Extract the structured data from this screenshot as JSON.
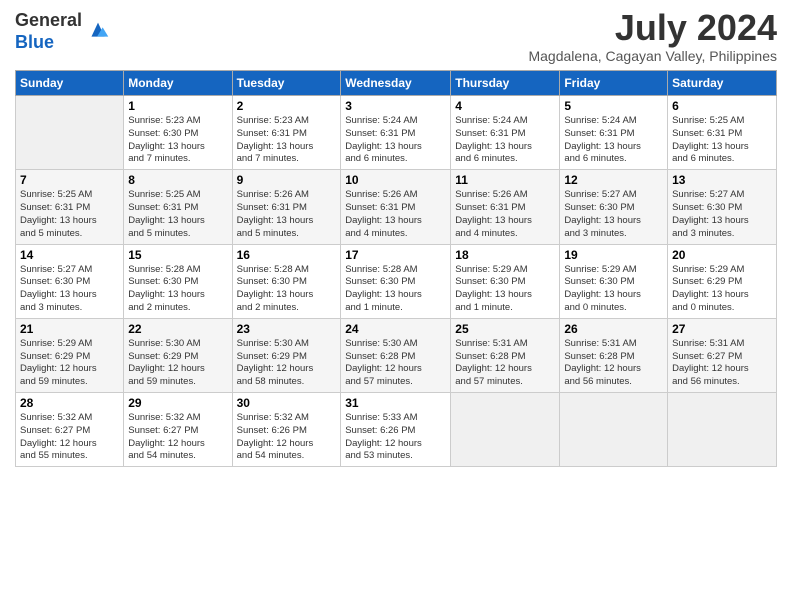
{
  "logo": {
    "general": "General",
    "blue": "Blue"
  },
  "title": "July 2024",
  "subtitle": "Magdalena, Cagayan Valley, Philippines",
  "days_header": [
    "Sunday",
    "Monday",
    "Tuesday",
    "Wednesday",
    "Thursday",
    "Friday",
    "Saturday"
  ],
  "weeks": [
    [
      {
        "day": "",
        "info": ""
      },
      {
        "day": "1",
        "info": "Sunrise: 5:23 AM\nSunset: 6:30 PM\nDaylight: 13 hours\nand 7 minutes."
      },
      {
        "day": "2",
        "info": "Sunrise: 5:23 AM\nSunset: 6:31 PM\nDaylight: 13 hours\nand 7 minutes."
      },
      {
        "day": "3",
        "info": "Sunrise: 5:24 AM\nSunset: 6:31 PM\nDaylight: 13 hours\nand 6 minutes."
      },
      {
        "day": "4",
        "info": "Sunrise: 5:24 AM\nSunset: 6:31 PM\nDaylight: 13 hours\nand 6 minutes."
      },
      {
        "day": "5",
        "info": "Sunrise: 5:24 AM\nSunset: 6:31 PM\nDaylight: 13 hours\nand 6 minutes."
      },
      {
        "day": "6",
        "info": "Sunrise: 5:25 AM\nSunset: 6:31 PM\nDaylight: 13 hours\nand 6 minutes."
      }
    ],
    [
      {
        "day": "7",
        "info": "Sunrise: 5:25 AM\nSunset: 6:31 PM\nDaylight: 13 hours\nand 5 minutes."
      },
      {
        "day": "8",
        "info": "Sunrise: 5:25 AM\nSunset: 6:31 PM\nDaylight: 13 hours\nand 5 minutes."
      },
      {
        "day": "9",
        "info": "Sunrise: 5:26 AM\nSunset: 6:31 PM\nDaylight: 13 hours\nand 5 minutes."
      },
      {
        "day": "10",
        "info": "Sunrise: 5:26 AM\nSunset: 6:31 PM\nDaylight: 13 hours\nand 4 minutes."
      },
      {
        "day": "11",
        "info": "Sunrise: 5:26 AM\nSunset: 6:31 PM\nDaylight: 13 hours\nand 4 minutes."
      },
      {
        "day": "12",
        "info": "Sunrise: 5:27 AM\nSunset: 6:30 PM\nDaylight: 13 hours\nand 3 minutes."
      },
      {
        "day": "13",
        "info": "Sunrise: 5:27 AM\nSunset: 6:30 PM\nDaylight: 13 hours\nand 3 minutes."
      }
    ],
    [
      {
        "day": "14",
        "info": "Sunrise: 5:27 AM\nSunset: 6:30 PM\nDaylight: 13 hours\nand 3 minutes."
      },
      {
        "day": "15",
        "info": "Sunrise: 5:28 AM\nSunset: 6:30 PM\nDaylight: 13 hours\nand 2 minutes."
      },
      {
        "day": "16",
        "info": "Sunrise: 5:28 AM\nSunset: 6:30 PM\nDaylight: 13 hours\nand 2 minutes."
      },
      {
        "day": "17",
        "info": "Sunrise: 5:28 AM\nSunset: 6:30 PM\nDaylight: 13 hours\nand 1 minute."
      },
      {
        "day": "18",
        "info": "Sunrise: 5:29 AM\nSunset: 6:30 PM\nDaylight: 13 hours\nand 1 minute."
      },
      {
        "day": "19",
        "info": "Sunrise: 5:29 AM\nSunset: 6:30 PM\nDaylight: 13 hours\nand 0 minutes."
      },
      {
        "day": "20",
        "info": "Sunrise: 5:29 AM\nSunset: 6:29 PM\nDaylight: 13 hours\nand 0 minutes."
      }
    ],
    [
      {
        "day": "21",
        "info": "Sunrise: 5:29 AM\nSunset: 6:29 PM\nDaylight: 12 hours\nand 59 minutes."
      },
      {
        "day": "22",
        "info": "Sunrise: 5:30 AM\nSunset: 6:29 PM\nDaylight: 12 hours\nand 59 minutes."
      },
      {
        "day": "23",
        "info": "Sunrise: 5:30 AM\nSunset: 6:29 PM\nDaylight: 12 hours\nand 58 minutes."
      },
      {
        "day": "24",
        "info": "Sunrise: 5:30 AM\nSunset: 6:28 PM\nDaylight: 12 hours\nand 57 minutes."
      },
      {
        "day": "25",
        "info": "Sunrise: 5:31 AM\nSunset: 6:28 PM\nDaylight: 12 hours\nand 57 minutes."
      },
      {
        "day": "26",
        "info": "Sunrise: 5:31 AM\nSunset: 6:28 PM\nDaylight: 12 hours\nand 56 minutes."
      },
      {
        "day": "27",
        "info": "Sunrise: 5:31 AM\nSunset: 6:27 PM\nDaylight: 12 hours\nand 56 minutes."
      }
    ],
    [
      {
        "day": "28",
        "info": "Sunrise: 5:32 AM\nSunset: 6:27 PM\nDaylight: 12 hours\nand 55 minutes."
      },
      {
        "day": "29",
        "info": "Sunrise: 5:32 AM\nSunset: 6:27 PM\nDaylight: 12 hours\nand 54 minutes."
      },
      {
        "day": "30",
        "info": "Sunrise: 5:32 AM\nSunset: 6:26 PM\nDaylight: 12 hours\nand 54 minutes."
      },
      {
        "day": "31",
        "info": "Sunrise: 5:33 AM\nSunset: 6:26 PM\nDaylight: 12 hours\nand 53 minutes."
      },
      {
        "day": "",
        "info": ""
      },
      {
        "day": "",
        "info": ""
      },
      {
        "day": "",
        "info": ""
      }
    ]
  ]
}
